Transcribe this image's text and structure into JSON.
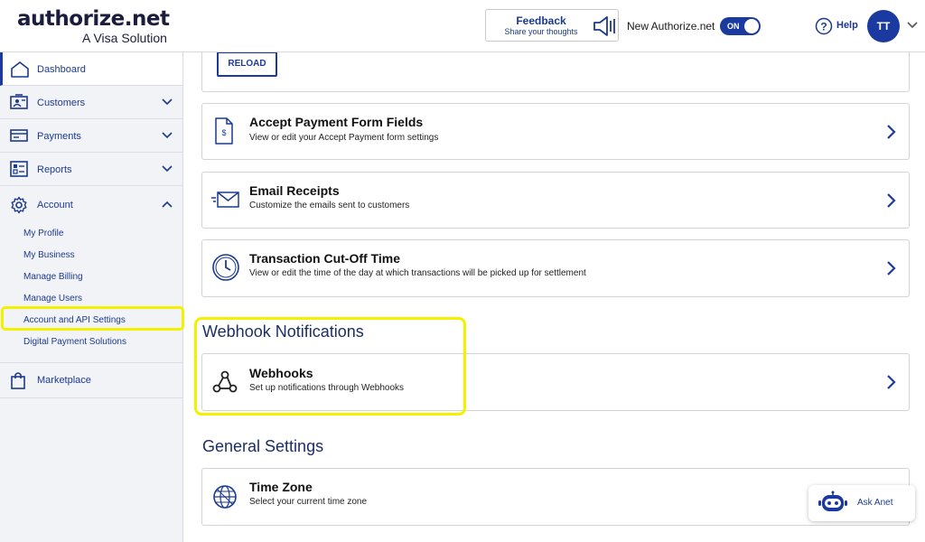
{
  "header": {
    "logo_main": "authorize.net",
    "logo_sub": "A Visa Solution",
    "feedback_title": "Feedback",
    "feedback_sub": "Share your thoughts",
    "new_auth_label": "New Authorize.net",
    "toggle_state": "ON",
    "help_label": "Help",
    "avatar_initials": "TT"
  },
  "sidebar": {
    "items": [
      {
        "label": "Dashboard",
        "icon": "home-icon"
      },
      {
        "label": "Customers",
        "icon": "customer-card-icon"
      },
      {
        "label": "Payments",
        "icon": "payment-card-icon"
      },
      {
        "label": "Reports",
        "icon": "reports-icon"
      },
      {
        "label": "Account",
        "icon": "gear-icon"
      },
      {
        "label": "Marketplace",
        "icon": "shopping-bag-icon"
      }
    ],
    "account_subitems": [
      "My Profile",
      "My Business",
      "Manage Billing",
      "Manage Users",
      "Account and API Settings",
      "Digital Payment Solutions"
    ]
  },
  "main": {
    "reload_label": "RELOAD",
    "cards": [
      {
        "title": "Accept Payment Form Fields",
        "desc": "View or edit your Accept Payment form settings",
        "icon": "document-dollar-icon"
      },
      {
        "title": "Email Receipts",
        "desc": "Customize the emails sent to customers",
        "icon": "envelope-icon"
      },
      {
        "title": "Transaction Cut-Off Time",
        "desc": "View or edit the time of the day at which transactions will be picked up for settlement",
        "icon": "clock-icon"
      }
    ],
    "webhook_section": "Webhook Notifications",
    "webhook_card": {
      "title": "Webhooks",
      "desc": "Set up notifications through Webhooks",
      "icon": "webhook-icon"
    },
    "general_section": "General Settings",
    "timezone_card": {
      "title": "Time Zone",
      "desc": "Select your current time zone",
      "icon": "globe-icon"
    }
  },
  "ask_anet": {
    "label": "Ask Anet",
    "icon": "robot-icon"
  },
  "colors": {
    "brand_blue": "#1b3aa0",
    "highlight_yellow": "#f3f000"
  }
}
